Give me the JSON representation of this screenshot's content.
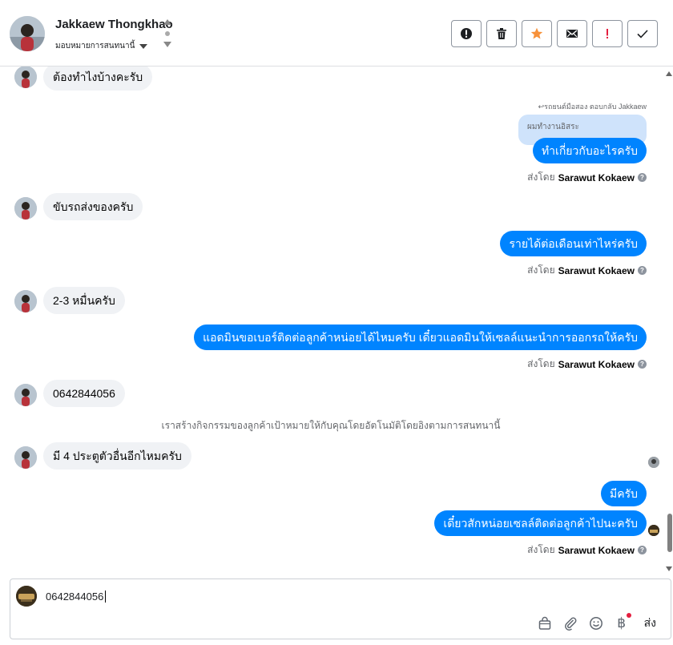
{
  "header": {
    "contact_name": "Jakkaew Thongkhao",
    "assign_label": "มอบหมายการสนทนานี้",
    "actions": [
      {
        "name": "report-button",
        "icon": "exclamation-circle-icon",
        "color": "#1c1e21"
      },
      {
        "name": "delete-button",
        "icon": "trash-icon",
        "color": "#1c1e21"
      },
      {
        "name": "star-button",
        "icon": "star-icon",
        "color": "#f7923b"
      },
      {
        "name": "email-button",
        "icon": "envelope-icon",
        "color": "#1c1e21"
      },
      {
        "name": "important-button",
        "icon": "exclamation-icon",
        "color": "#e41e3f"
      },
      {
        "name": "done-button",
        "icon": "checkmark-icon",
        "color": "#1c1e21"
      }
    ]
  },
  "messages": {
    "in_1": "ต้องทำไงบ้างคะรับ",
    "reply_note": "รถยนต์มือสอง ตอบกลับ Jakkaew",
    "quoted": "ผมทำงานอิสระ",
    "out_1": "ทำเกี่ยวกับอะไรครับ",
    "in_2": "ขับรถส่งของครับ",
    "out_2": "รายได้ต่อเดือนเท่าไหร่ครับ",
    "in_3": "2-3 หมื่นครับ",
    "out_3": "แอดมินขอเบอร์ติดต่อลูกค้าหน่อยได้ไหมครับ เดี๋ยวแอดมินให้เซลล์แนะนำการออกรถให้ครับ",
    "in_4": "0642844056",
    "system_note": "เราสร้างกิจกรรมของลูกค้าเป้าหมายให้กับคุณโดยอัตโนมัติโดยอิงตามการสนทนานี้",
    "in_5": "มี 4 ประตูตัวอื่นอีกไหมครับ",
    "out_4": "มีครับ",
    "out_5": "เดี๋ยวสักหน่อยเซลล์ติดต่อลูกค้าไปนะครับ",
    "sent_by_prefix": "ส่งโดย",
    "sent_by_name": "Sarawut Kokaew"
  },
  "composer": {
    "text": "0642844056",
    "send_label": "ส่ง"
  },
  "colors": {
    "outgoing_bubble": "#0084ff",
    "incoming_bubble": "#f0f2f5",
    "quoted_bubble": "#cfe3fb"
  }
}
